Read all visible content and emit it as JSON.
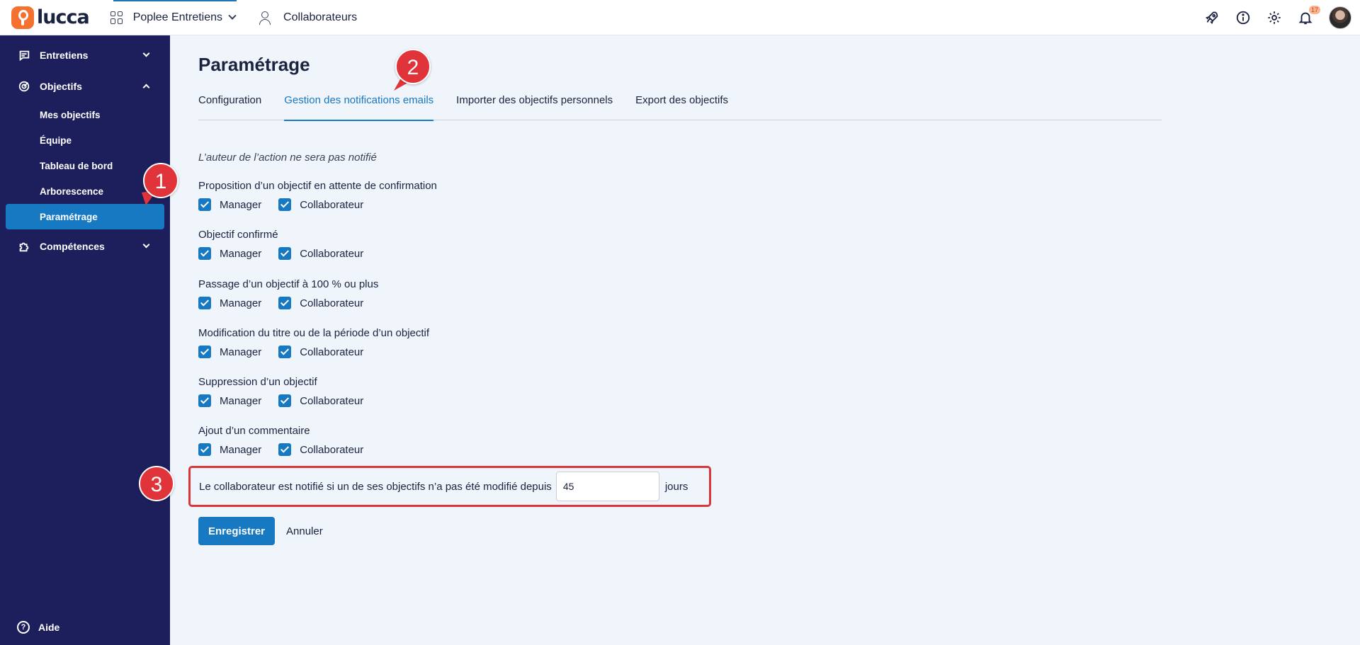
{
  "topbar": {
    "logo_text": "lucca",
    "app_name": "Poplee Entretiens",
    "collaborateurs": "Collaborateurs",
    "notifications_count": "17",
    "icons": [
      "rocket-icon",
      "info-icon",
      "gear-icon",
      "bell-icon"
    ]
  },
  "sidebar": {
    "entretiens": "Entretiens",
    "objectifs": "Objectifs",
    "items": [
      "Mes objectifs",
      "Équipe",
      "Tableau de bord",
      "Arborescence",
      "Paramétrage"
    ],
    "competences": "Compétences",
    "aide": "Aide"
  },
  "main": {
    "title": "Paramétrage",
    "tabs": [
      "Configuration",
      "Gestion des notifications emails",
      "Importer des objectifs personnels",
      "Export des objectifs"
    ],
    "active_tab": "Gestion des notifications emails",
    "note": "L’auteur de l’action ne sera pas notifié",
    "manager_label": "Manager",
    "collab_label": "Collaborateur",
    "groups": [
      "Proposition d’un objectif en attente de confirmation",
      "Objectif confirmé",
      "Passage d’un objectif à 100 % ou plus",
      "Modification du titre ou de la période d’un objectif",
      "Suppression d’un objectif",
      "Ajout d’un commentaire"
    ],
    "delay_text": "Le collaborateur est notifié si un de ses objectifs n’a pas été modifié depuis",
    "delay_value": "45",
    "delay_unit": "jours",
    "save": "Enregistrer",
    "cancel": "Annuler"
  },
  "callouts": [
    "1",
    "2",
    "3"
  ],
  "colors": {
    "sidebar": "#1d1f5c",
    "accent": "#1679c2",
    "callout": "#e1343a",
    "logo": "#f4712f"
  }
}
